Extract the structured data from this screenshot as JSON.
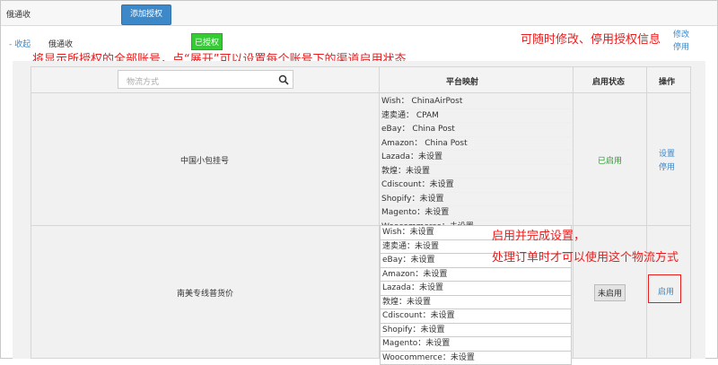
{
  "topbar": {
    "title": "俄通收",
    "add_button": "添加授权"
  },
  "account": {
    "collapse_label": "- 收起",
    "name": "俄通收",
    "status_badge": "已授权",
    "edit_label": "修改",
    "disable_label": "停用"
  },
  "annotations": {
    "top_right": "可随时修改、停用授权信息",
    "top_left": "将显示所授权的全部账号，点“展开”可以设置每个账号下的渠道启用状态",
    "mid_right_1": "启用并完成设置，",
    "mid_right_2": "处理订单时才可以使用这个物流方式"
  },
  "table": {
    "search_placeholder": "物流方式",
    "headers": {
      "mapping": "平台映射",
      "status": "启用状态",
      "action": "操作"
    },
    "rows": [
      {
        "name": "中国小包挂号",
        "mappings": [
          "Wish： ChinaAirPost",
          "速卖通： CPAM",
          "eBay： China Post",
          "Amazon： China Post",
          "Lazada：未设置",
          "敦煌：未设置",
          "Cdiscount：未设置",
          "Shopify：未设置",
          "Magento：未设置",
          "Woocommerce：未设置"
        ],
        "status": "已启用",
        "actions": [
          "设置",
          "停用"
        ]
      },
      {
        "name": "南美专线普货价",
        "mappings": [
          "Wish：未设置",
          "速卖通：未设置",
          "eBay：未设置",
          "Amazon：未设置",
          "Lazada：未设置",
          "敦煌：未设置",
          "Cdiscount：未设置",
          "Shopify：未设置",
          "Magento：未设置",
          "Woocommerce：未设置"
        ],
        "status": "未启用",
        "actions": [
          "启用"
        ]
      }
    ]
  },
  "colors": {
    "accent": "#3d88c9",
    "annotation": "#e81d1d",
    "enabled": "#2ca02c",
    "badge_green": "#33cc33"
  },
  "icons": {
    "search": "search-icon"
  }
}
